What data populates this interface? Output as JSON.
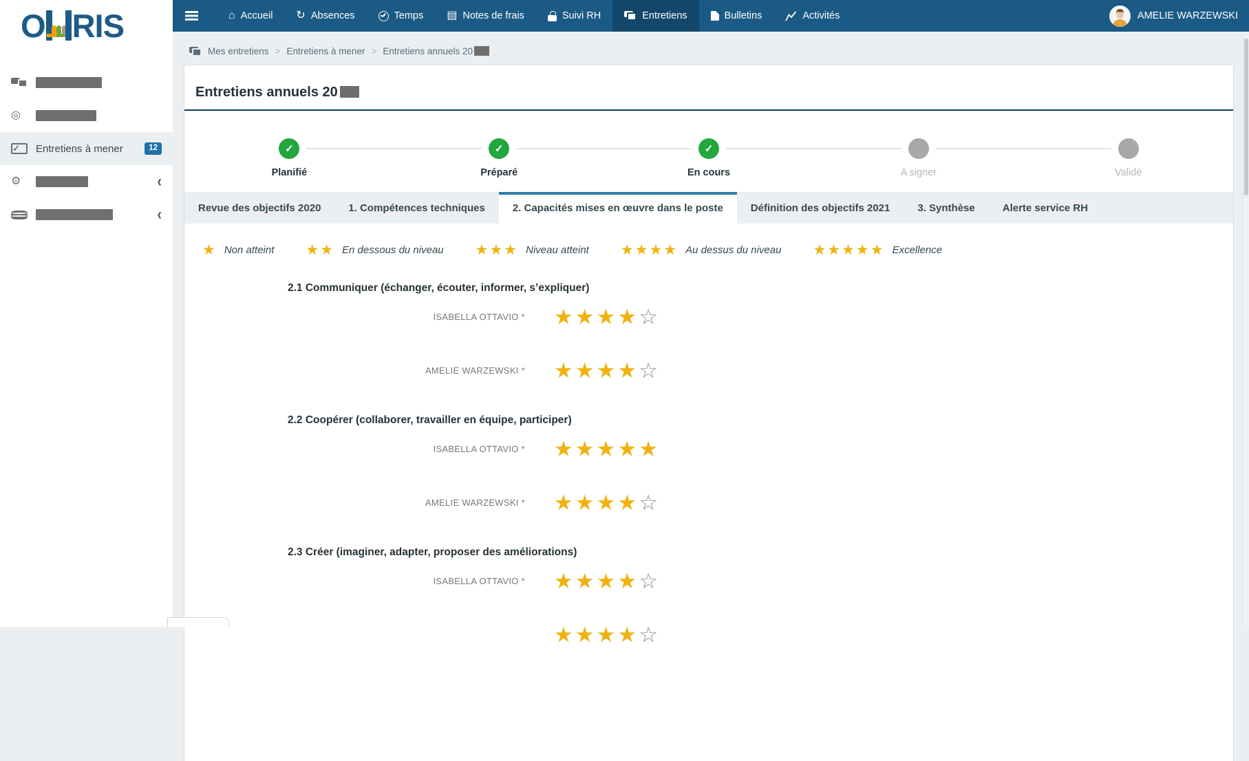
{
  "nav": {
    "menu_icon": "hamburger-icon",
    "items": [
      {
        "label": "Accueil",
        "icon": "home-icon",
        "active": false
      },
      {
        "label": "Absences",
        "icon": "refresh-icon",
        "active": false
      },
      {
        "label": "Temps",
        "icon": "clock-icon",
        "active": false
      },
      {
        "label": "Notes de frais",
        "icon": "receipt-icon",
        "active": false
      },
      {
        "label": "Suivi RH",
        "icon": "lock-icon",
        "active": false
      },
      {
        "label": "Entretiens",
        "icon": "chat-icon",
        "active": true
      },
      {
        "label": "Bulletins",
        "icon": "document-icon",
        "active": false
      },
      {
        "label": "Activités",
        "icon": "chart-icon",
        "active": false
      }
    ],
    "user": {
      "name": "AMELIE WARZEWSKI",
      "avatar": "avatar-image"
    }
  },
  "sidebar": {
    "logo": "OHRIS",
    "items": [
      {
        "icon": "chat-icon",
        "label": "",
        "redacted": true,
        "active": false
      },
      {
        "icon": "target-icon",
        "label": "",
        "redacted": true,
        "active": false
      },
      {
        "icon": "checklist-icon",
        "label": "Entretiens à mener",
        "badge": "12",
        "redacted": false,
        "active": true
      },
      {
        "icon": "gear-icon",
        "label": "",
        "redacted": true,
        "active": false,
        "chevron": true
      },
      {
        "icon": "database-icon",
        "label": "",
        "redacted": true,
        "active": false,
        "chevron": true
      }
    ]
  },
  "breadcrumb": {
    "icon": "chat-icon",
    "separator": ">",
    "items": [
      {
        "label": "Mes entretiens",
        "redacted_suffix": false
      },
      {
        "label": "Entretiens à mener",
        "redacted_suffix": false
      },
      {
        "label": "Entretiens annuels 20",
        "redacted_suffix": true
      }
    ]
  },
  "page": {
    "title": "Entretiens annuels 20",
    "title_redacted_suffix": true
  },
  "stepper": {
    "steps": [
      {
        "label": "Planifié",
        "state": "done"
      },
      {
        "label": "Préparé",
        "state": "done"
      },
      {
        "label": "En cours",
        "state": "done"
      },
      {
        "label": "A signer",
        "state": "pending"
      },
      {
        "label": "Validé",
        "state": "pending"
      }
    ]
  },
  "tabs": [
    {
      "label": "Revue des objectifs 2020",
      "active": false
    },
    {
      "label": "1. Compétences techniques",
      "active": false
    },
    {
      "label": "2. Capacités mises en œuvre dans le poste",
      "active": true
    },
    {
      "label": "Définition des objectifs 2021",
      "active": false
    },
    {
      "label": "3. Synthèse",
      "active": false
    },
    {
      "label": "Alerte service RH",
      "active": false
    }
  ],
  "rating_legend": [
    {
      "stars": 1,
      "label": "Non atteint"
    },
    {
      "stars": 2,
      "label": "En dessous du niveau"
    },
    {
      "stars": 3,
      "label": "Niveau atteint"
    },
    {
      "stars": 4,
      "label": "Au dessus du niveau"
    },
    {
      "stars": 5,
      "label": "Excellence"
    }
  ],
  "sections": [
    {
      "heading": "2.1 Communiquer (échanger, écouter, informer, s’expliquer)",
      "ratings": [
        {
          "name": "ISABELLA OTTAVIO *",
          "value": 4,
          "max": 5
        },
        {
          "name": "AMELIE WARZEWSKI *",
          "value": 4,
          "max": 5
        }
      ]
    },
    {
      "heading": "2.2 Coopérer (collaborer, travailler en équipe, participer)",
      "ratings": [
        {
          "name": "ISABELLA OTTAVIO *",
          "value": 5,
          "max": 5
        },
        {
          "name": "AMELIE WARZEWSKI *",
          "value": 4,
          "max": 5
        }
      ]
    },
    {
      "heading": "2.3 Créer (imaginer, adapter, proposer des améliorations)",
      "ratings": [
        {
          "name": "ISABELLA OTTAVIO *",
          "value": 4,
          "max": 5
        },
        {
          "name": "",
          "value": 4,
          "max": 5
        }
      ]
    }
  ],
  "icons": {
    "star-filled": "★",
    "star-empty": "☆",
    "check": "✓",
    "chevron-left": "‹",
    "home-icon": "⌂",
    "refresh-icon": "↻",
    "receipt-icon": "▤",
    "target-icon": "◎",
    "gear-icon": "⚙"
  },
  "colors": {
    "nav_blue": "#1b5a84",
    "nav_active": "#12476b",
    "content_bg": "#eceff1",
    "step_done_green": "#23a63e",
    "step_pending_gray": "#a8a8a8",
    "star_gold": "#efb211",
    "tab_accent_blue": "#2e80a8",
    "badge_blue": "#1d72a8",
    "title_underline": "#0d3c5f",
    "redaction_gray": "#6f6f6f"
  }
}
